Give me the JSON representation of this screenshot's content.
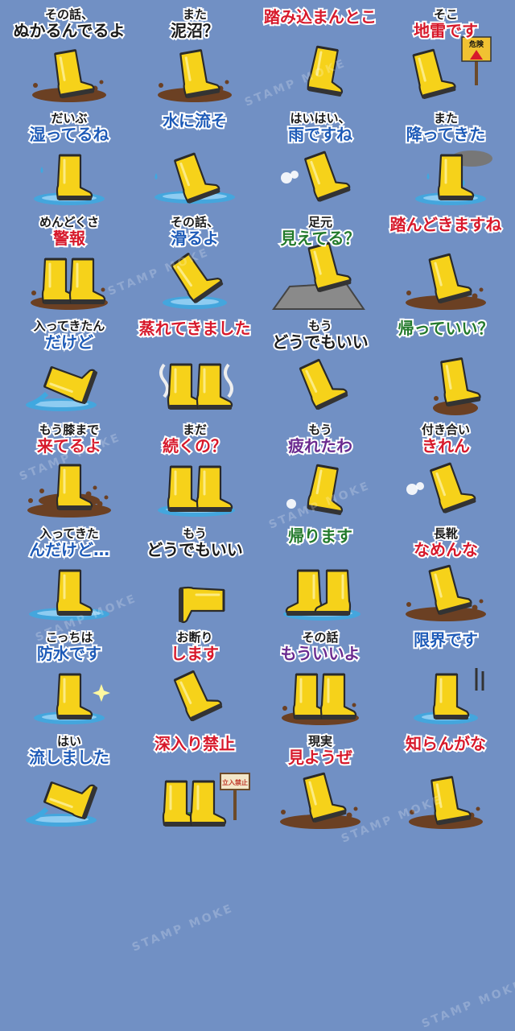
{
  "colors": {
    "background": "#7190c4",
    "boot": "#f6d21a",
    "mud": "#6b4023",
    "water": "#3fa8e0",
    "text_black": "#1a1a1a",
    "text_red": "#d7192b",
    "text_blue": "#1e5bb8",
    "text_green": "#237a2c",
    "text_purple": "#6a2a8f"
  },
  "watermark": "STAMP MOKE",
  "stickers": [
    {
      "lines": [
        "その話、",
        "ぬかるんでるよ"
      ],
      "accent": "black",
      "scene": "mud"
    },
    {
      "lines": [
        "また",
        "泥沼？"
      ],
      "accent": "black",
      "scene": "mud"
    },
    {
      "lines": [
        "踏み込まんとこ"
      ],
      "accent": "red",
      "scene": "step"
    },
    {
      "lines": [
        "そこ",
        "地雷です"
      ],
      "accent": "red",
      "scene": "sign",
      "sign": "危険"
    },
    {
      "lines": [
        "だいぶ",
        "湿ってるね"
      ],
      "accent": "blue",
      "scene": "water"
    },
    {
      "lines": [
        "水に流そ"
      ],
      "accent": "blue",
      "scene": "splash"
    },
    {
      "lines": [
        "はいはい、",
        "雨ですね"
      ],
      "accent": "blue",
      "scene": "kick"
    },
    {
      "lines": [
        "また",
        "降ってきた"
      ],
      "accent": "blue",
      "scene": "rain"
    },
    {
      "lines": [
        "めんどくさ",
        "警報"
      ],
      "accent": "red",
      "scene": "pair-mud"
    },
    {
      "lines": [
        "その話、",
        "滑るよ"
      ],
      "accent": "blue",
      "scene": "slip"
    },
    {
      "lines": [
        "足元",
        "見えてる？"
      ],
      "accent": "green",
      "scene": "rock"
    },
    {
      "lines": [
        "踏んどきますね"
      ],
      "accent": "red",
      "scene": "stomp"
    },
    {
      "lines": [
        "入ってきたん",
        "だけど"
      ],
      "accent": "blue",
      "scene": "pour"
    },
    {
      "lines": [
        "蒸れてきました"
      ],
      "accent": "red",
      "scene": "steam"
    },
    {
      "lines": [
        "もう",
        "どうでもいい"
      ],
      "accent": "black",
      "scene": "tilt"
    },
    {
      "lines": [
        "帰っていい？"
      ],
      "accent": "green",
      "scene": "walk"
    },
    {
      "lines": [
        "もう膝まで",
        "来てるよ"
      ],
      "accent": "red",
      "scene": "deep-mud"
    },
    {
      "lines": [
        "まだ",
        "続くの？"
      ],
      "accent": "red",
      "scene": "pair-water"
    },
    {
      "lines": [
        "もう",
        "疲れたわ"
      ],
      "accent": "purple",
      "scene": "slump"
    },
    {
      "lines": [
        "付き合い",
        "きれん"
      ],
      "accent": "red",
      "scene": "kick"
    },
    {
      "lines": [
        "入ってきた",
        "んだけど…"
      ],
      "accent": "blue",
      "scene": "overflow"
    },
    {
      "lines": [
        "もう",
        "どうでもいい"
      ],
      "accent": "black",
      "scene": "lying"
    },
    {
      "lines": [
        "帰ります"
      ],
      "accent": "green",
      "scene": "pair-back"
    },
    {
      "lines": [
        "長靴",
        "なめんな"
      ],
      "accent": "red",
      "scene": "stomp"
    },
    {
      "lines": [
        "こっちは",
        "防水です"
      ],
      "accent": "blue",
      "scene": "sparkle"
    },
    {
      "lines": [
        "お断り",
        "します"
      ],
      "accent": "red",
      "scene": "tilt"
    },
    {
      "lines": [
        "その話",
        "もういいよ"
      ],
      "accent": "purple",
      "scene": "pair-mud"
    },
    {
      "lines": [
        "限界です"
      ],
      "accent": "blue",
      "scene": "sweat"
    },
    {
      "lines": [
        "はい",
        "流しました"
      ],
      "accent": "blue",
      "scene": "pour"
    },
    {
      "lines": [
        "深入り禁止"
      ],
      "accent": "red",
      "scene": "sign-pair",
      "sign": "立入禁止"
    },
    {
      "lines": [
        "現実",
        "見ようぜ"
      ],
      "accent": "red",
      "scene": "stomp"
    },
    {
      "lines": [
        "知らんがな"
      ],
      "accent": "red",
      "scene": "mud"
    }
  ]
}
